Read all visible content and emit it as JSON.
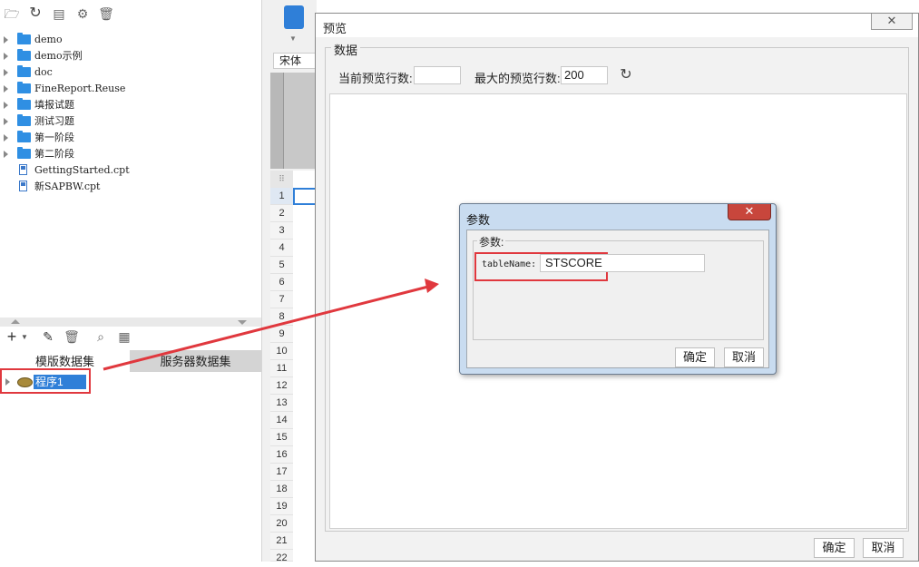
{
  "file_tree": [
    {
      "label": "demo",
      "type": "folder"
    },
    {
      "label": "demo示例",
      "type": "folder"
    },
    {
      "label": "doc",
      "type": "folder"
    },
    {
      "label": "FineReport.Reuse",
      "type": "folder"
    },
    {
      "label": "填报试题",
      "type": "folder"
    },
    {
      "label": "测试习题",
      "type": "folder"
    },
    {
      "label": "第一阶段",
      "type": "folder"
    },
    {
      "label": "第二阶段",
      "type": "folder"
    },
    {
      "label": "GettingStarted.cpt",
      "type": "file"
    },
    {
      "label": "新SAPBW.cpt",
      "type": "file"
    }
  ],
  "dataset_tabs": {
    "template": "模版数据集",
    "server": "服务器数据集"
  },
  "dataset_item": "程序1",
  "designer": {
    "font": "宋体",
    "row_numbers": [
      "1",
      "2",
      "3",
      "4",
      "5",
      "6",
      "7",
      "8",
      "9",
      "10",
      "11",
      "12",
      "13",
      "14",
      "15",
      "16",
      "17",
      "18",
      "19",
      "20",
      "21",
      "22"
    ]
  },
  "preview": {
    "title": "预览",
    "group_title": "数据",
    "current_rows_label": "当前预览行数:",
    "current_rows_value": "",
    "max_rows_label": "最大的预览行数:",
    "max_rows_value": "200",
    "ok": "确定",
    "cancel": "取消"
  },
  "params_dialog": {
    "title": "参数",
    "group_title": "参数:",
    "param_name": "tableName:",
    "param_value": "STSCORE",
    "ok": "确定",
    "cancel": "取消"
  },
  "colors": {
    "accent": "#2f7fd8",
    "highlight": "#e0383e",
    "folder": "#2f8fe3"
  }
}
